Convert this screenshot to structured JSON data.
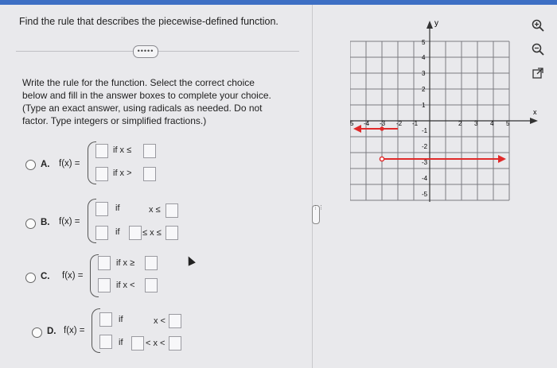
{
  "question": "Find the rule that describes the piecewise-defined function.",
  "more_label": "•••••",
  "instructions": [
    "Write the rule for the function. Select the correct choice",
    "below and fill in the answer boxes to complete your choice.",
    "(Type an exact answer, using radicals as needed. Do not",
    "factor. Type integers or simplified fractions.)"
  ],
  "options": {
    "A": {
      "letter": "A.",
      "fx": "f(x) =",
      "row1": "if  x ≤",
      "row2": "if  x >"
    },
    "B": {
      "letter": "B.",
      "fx": "f(x) =",
      "row1_if": "if",
      "row1_cond": "x ≤",
      "row2_if": "if",
      "row2_cond": "≤ x ≤"
    },
    "C": {
      "letter": "C.",
      "fx": "f(x) =",
      "row1": "if  x ≥",
      "row2": "if  x <"
    },
    "D": {
      "letter": "D.",
      "fx": "f(x) =",
      "row1_if": "if",
      "row1_cond": "x <",
      "row2_if": "if",
      "row2_cond": "< x <"
    }
  },
  "graph": {
    "y_axis_label": "y",
    "x_axis_label": "x",
    "x_ticks": [
      "5",
      "-4",
      "-3",
      "-2",
      "-1",
      "2",
      "3",
      "4",
      "5"
    ],
    "y_ticks_pos": [
      "5",
      "4",
      "3",
      "2",
      "1"
    ],
    "y_ticks_neg": [
      "-1",
      "-2",
      "-3",
      "-4",
      "-5"
    ],
    "segment_color": "#e02a2a"
  },
  "icons": [
    "zoom-in-icon",
    "zoom-out-icon",
    "external-link-icon"
  ],
  "handle_label": "⋮⋮"
}
